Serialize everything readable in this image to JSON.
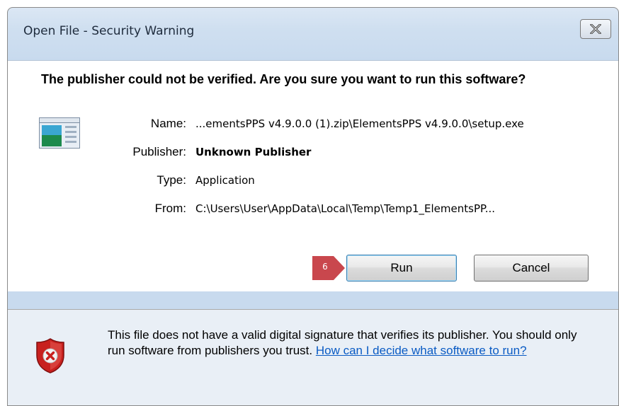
{
  "window": {
    "title": "Open File - Security Warning"
  },
  "heading": "The publisher could not be verified.  Are you sure you want to run this software?",
  "details": [
    {
      "label": "Name:",
      "value": "...ementsPPS v4.9.0.0 (1).zip\\ElementsPPS v4.9.0.0\\setup.exe"
    },
    {
      "label": "Publisher:",
      "value": "Unknown Publisher"
    },
    {
      "label": "Type:",
      "value": "Application"
    },
    {
      "label": "From:",
      "value": "C:\\Users\\User\\AppData\\Local\\Temp\\Temp1_ElementsPP..."
    }
  ],
  "buttons": {
    "run": "Run",
    "cancel": "Cancel"
  },
  "step_marker": "6",
  "warning": {
    "text": "This file does not have a valid digital signature that verifies its publisher. You should only run software from publishers you trust.",
    "link": "How can I decide what software to run?"
  },
  "icons": {
    "close": "close-icon",
    "app": "application-icon",
    "shield": "shield-error-icon"
  },
  "colors": {
    "accent_link": "#0a5bc4",
    "step_marker": "#c9474d",
    "shield_red": "#c8201e"
  }
}
